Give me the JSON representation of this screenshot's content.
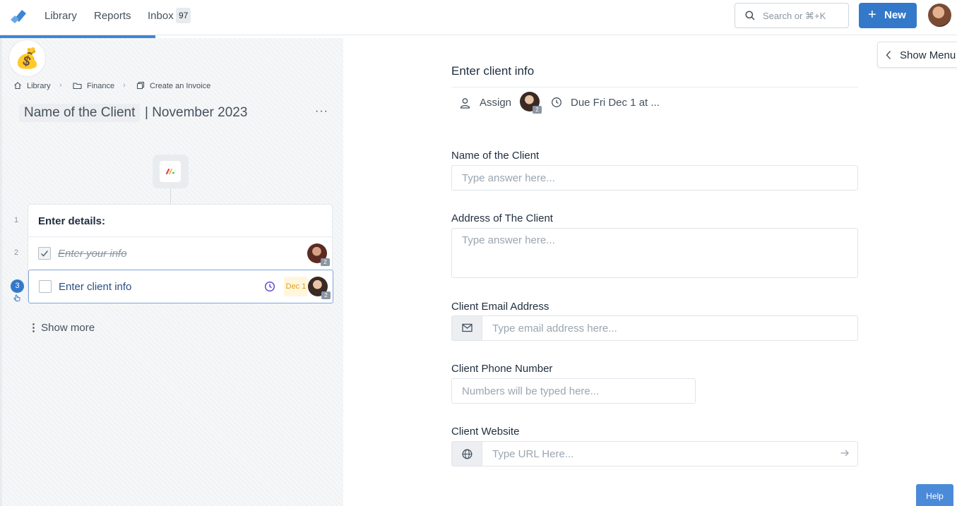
{
  "nav": {
    "library": "Library",
    "reports": "Reports",
    "inbox": "Inbox",
    "inbox_count": "97",
    "search_placeholder": "Search or ⌘+K",
    "new_label": "New"
  },
  "workflow": {
    "emoji": "💰",
    "breadcrumb": [
      "Library",
      "Finance",
      "Create an Invoice"
    ],
    "title_variable": "Name of the Client",
    "title_rest": "| November 2023",
    "more": "···",
    "tasks": [
      {
        "number": "1",
        "label": "Enter details:"
      },
      {
        "number": "2",
        "label": "Enter your info",
        "completed": true,
        "assignee_count": "2"
      },
      {
        "number": "3",
        "label": "Enter client info",
        "completed": false,
        "due": "Dec 1",
        "assignee_count": "2"
      }
    ],
    "show_more": "Show more"
  },
  "form": {
    "title": "Enter client info",
    "assign_label": "Assign",
    "assignee_count": "2",
    "due_label": "Due Fri Dec 1 at ...",
    "fields": [
      {
        "label": "Name of the Client",
        "placeholder": "Type answer here..."
      },
      {
        "label": "Address of The Client",
        "placeholder": "Type answer here..."
      },
      {
        "label": "Client Email Address",
        "placeholder": "Type email address here..."
      },
      {
        "label": "Client Phone Number",
        "placeholder": "Numbers will be typed here..."
      },
      {
        "label": "Client Website",
        "placeholder": "Type URL Here..."
      }
    ]
  },
  "show_menu": "Show Menu",
  "help": "Help",
  "colors": {
    "primary": "#3479c9",
    "due_badge": "#e0a11b",
    "progress": "#3d86d6"
  }
}
